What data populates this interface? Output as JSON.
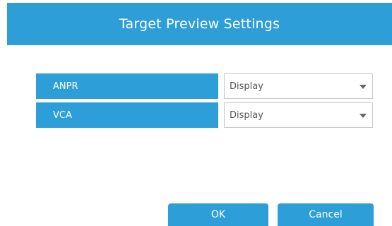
{
  "dialog": {
    "title": "Target Preview Settings"
  },
  "rows": [
    {
      "label": "ANPR",
      "value": "Display"
    },
    {
      "label": "VCA",
      "value": "Display"
    }
  ],
  "buttons": {
    "ok_label": "OK",
    "cancel_label": "Cancel"
  },
  "icons": {
    "dropdown": "chevron-down-icon"
  },
  "colors": {
    "accent": "#2e9ed9",
    "select_border": "#c8c8c8",
    "select_text": "#555555"
  }
}
